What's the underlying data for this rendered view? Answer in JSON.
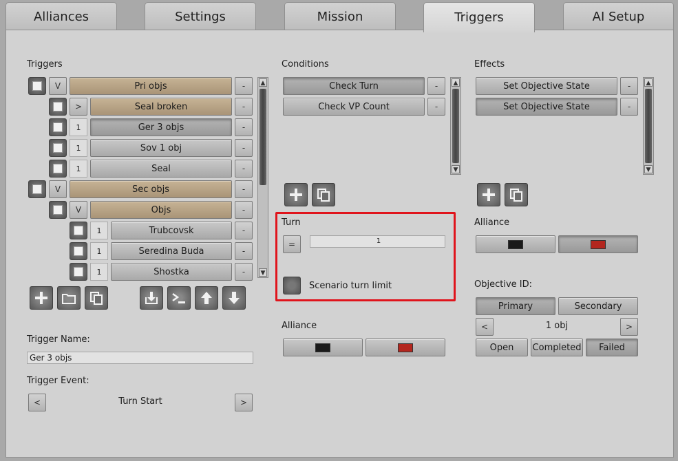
{
  "tabs": [
    {
      "label": "Alliances"
    },
    {
      "label": "Settings"
    },
    {
      "label": "Mission"
    },
    {
      "label": "Triggers"
    },
    {
      "label": "AI Setup"
    }
  ],
  "triggers": {
    "heading": "Triggers",
    "rows": [
      {
        "toggle": "V",
        "label": "Pri objs",
        "minus": "-"
      },
      {
        "toggle": ">",
        "label": "Seal broken",
        "minus": "-"
      },
      {
        "toggle": "1",
        "label": "Ger 3 objs",
        "minus": "-"
      },
      {
        "toggle": "1",
        "label": "Sov 1 obj",
        "minus": "-"
      },
      {
        "toggle": "1",
        "label": "Seal",
        "minus": "-"
      },
      {
        "toggle": "V",
        "label": "Sec objs",
        "minus": "-"
      },
      {
        "toggle": "V",
        "label": "Objs",
        "minus": "-"
      },
      {
        "toggle": "1",
        "label": "Trubcovsk",
        "minus": "-"
      },
      {
        "toggle": "1",
        "label": "Seredina Buda",
        "minus": "-"
      },
      {
        "toggle": "1",
        "label": "Shostka",
        "minus": "-"
      }
    ],
    "name_label": "Trigger Name:",
    "name_value": "Ger 3 objs",
    "event_label": "Trigger Event:",
    "event_value": "Turn Start",
    "event_prev": "<",
    "event_next": ">"
  },
  "conditions": {
    "heading": "Conditions",
    "items": [
      {
        "label": "Check Turn",
        "minus": "-"
      },
      {
        "label": "Check VP Count",
        "minus": "-"
      }
    ]
  },
  "turn": {
    "heading": "Turn",
    "operator": "=",
    "value": "1",
    "scenario_limit_label": "Scenario turn limit"
  },
  "condition_alliance": {
    "heading": "Alliance"
  },
  "effects": {
    "heading": "Effects",
    "items": [
      {
        "label": "Set Objective State",
        "minus": "-"
      },
      {
        "label": "Set Objective State",
        "minus": "-"
      }
    ]
  },
  "effect_alliance": {
    "heading": "Alliance"
  },
  "objective": {
    "heading": "Objective ID:",
    "primary": "Primary",
    "secondary": "Secondary",
    "prev": "<",
    "next": ">",
    "value": "1 obj",
    "states": [
      "Open",
      "Completed",
      "Failed"
    ]
  },
  "colors": {
    "alliance_black": "#1a1a1a",
    "alliance_red": "#b3261e",
    "highlight_red": "#e0141c"
  }
}
